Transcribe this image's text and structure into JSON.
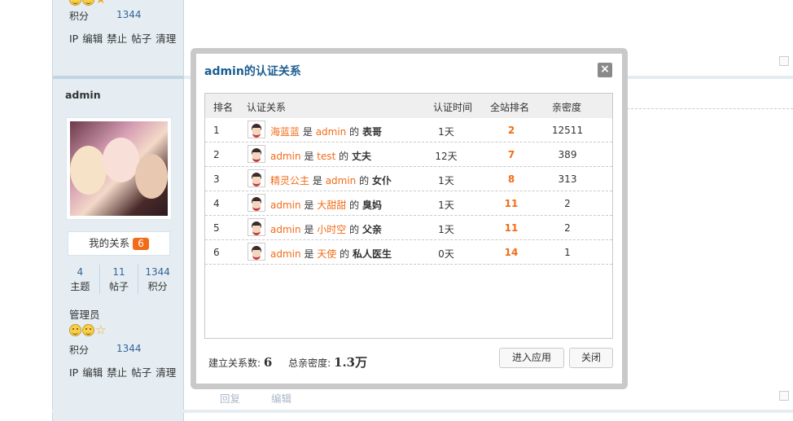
{
  "sidebar": {
    "top_credit_label": "积分",
    "top_credit_value": "1344",
    "top_actions": [
      "IP",
      "编辑",
      "禁止",
      "帖子",
      "清理"
    ],
    "username": "admin",
    "my_relation_label": "我的关系",
    "my_relation_count": "6",
    "stats": [
      {
        "value": "4",
        "label": "主题"
      },
      {
        "value": "11",
        "label": "帖子"
      },
      {
        "value": "1344",
        "label": "积分"
      }
    ],
    "role": "管理员",
    "credit_label": "积分",
    "credit_value": "1344",
    "actions": [
      "IP",
      "编辑",
      "禁止",
      "帖子",
      "清理"
    ]
  },
  "post_footer": {
    "reply": "回复",
    "edit": "编辑"
  },
  "modal": {
    "title": "admin的认证关系",
    "headers": {
      "rank": "排名",
      "relation": "认证关系",
      "time": "认证时间",
      "site_rank": "全站排名",
      "intimacy": "亲密度"
    },
    "rows": [
      {
        "rank": "1",
        "subject": "海蓝蓝",
        "is": "是",
        "object": "admin",
        "of": "的",
        "role": "表哥",
        "time": "1天",
        "site_rank": "2",
        "intimacy": "12511"
      },
      {
        "rank": "2",
        "subject": "admin",
        "is": "是",
        "object": "test",
        "of": "的",
        "role": "丈夫",
        "time": "12天",
        "site_rank": "7",
        "intimacy": "389"
      },
      {
        "rank": "3",
        "subject": "精灵公主",
        "is": "是",
        "object": "admin",
        "of": "的",
        "role": "女仆",
        "time": "1天",
        "site_rank": "8",
        "intimacy": "313"
      },
      {
        "rank": "4",
        "subject": "admin",
        "is": "是",
        "object": "大甜甜",
        "of": "的",
        "role": "臭妈",
        "time": "1天",
        "site_rank": "11",
        "intimacy": "2"
      },
      {
        "rank": "5",
        "subject": "admin",
        "is": "是",
        "object": "小时空",
        "of": "的",
        "role": "父亲",
        "time": "1天",
        "site_rank": "11",
        "intimacy": "2"
      },
      {
        "rank": "6",
        "subject": "admin",
        "is": "是",
        "object": "天使",
        "of": "的",
        "role": "私人医生",
        "time": "0天",
        "site_rank": "14",
        "intimacy": "1"
      }
    ],
    "footer": {
      "count_label": "建立关系数:",
      "count_value": "6",
      "intimacy_label": "总亲密度:",
      "intimacy_value": "1.3万"
    },
    "enter_button": "进入应用",
    "close_button": "关闭",
    "close_icon": "×"
  },
  "colors": {
    "accent_orange": "#f26c18",
    "title_blue": "#1c5d91",
    "sidebar_bg": "#e5edf2"
  }
}
